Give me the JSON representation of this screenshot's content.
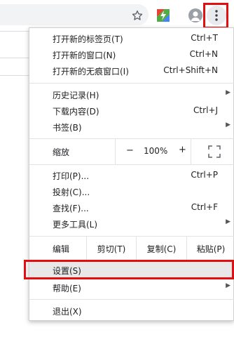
{
  "toolbar": {
    "star_icon": "star-icon",
    "extension_icon": "extension-icon",
    "avatar_icon": "avatar-icon",
    "menu_icon": "more-vert-icon"
  },
  "menu": {
    "new_tab": {
      "label": "打开新的标签页(T)",
      "shortcut": "Ctrl+T"
    },
    "new_window": {
      "label": "打开新的窗口(N)",
      "shortcut": "Ctrl+N"
    },
    "new_incognito": {
      "label": "打开新的无痕窗口(I)",
      "shortcut": "Ctrl+Shift+N"
    },
    "history": {
      "label": "历史记录(H)"
    },
    "downloads": {
      "label": "下载内容(D)",
      "shortcut": "Ctrl+J"
    },
    "bookmarks": {
      "label": "书签(B)"
    },
    "zoom": {
      "label": "缩放",
      "minus": "−",
      "value": "100%",
      "plus": "+"
    },
    "print": {
      "label": "打印(P)...",
      "shortcut": "Ctrl+P"
    },
    "cast": {
      "label": "投射(C)..."
    },
    "find": {
      "label": "查找(F)...",
      "shortcut": "Ctrl+F"
    },
    "more_tools": {
      "label": "更多工具(L)"
    },
    "edit": {
      "label": "编辑",
      "cut": "剪切(T)",
      "copy": "复制(C)",
      "paste": "粘贴(P)"
    },
    "settings": {
      "label": "设置(S)"
    },
    "help": {
      "label": "帮助(E)"
    },
    "exit": {
      "label": "退出(X)"
    }
  },
  "colors": {
    "highlight": "#e01010",
    "menu_bg": "#ffffff",
    "hover": "#e8e8e8"
  }
}
